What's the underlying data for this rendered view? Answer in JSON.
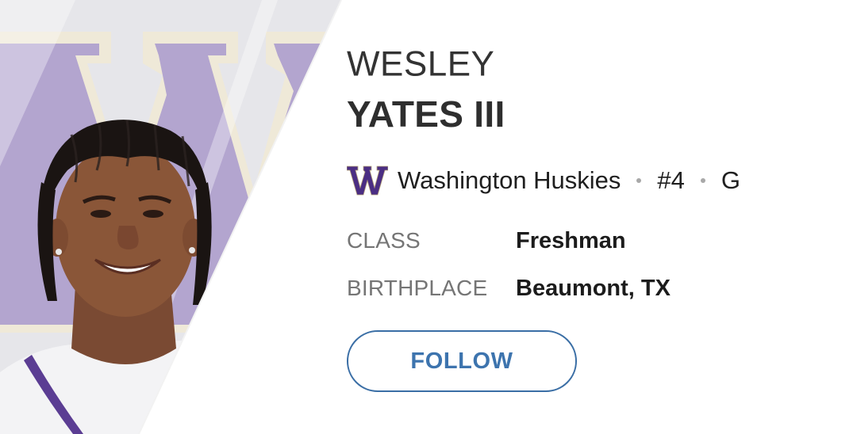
{
  "player": {
    "first_name": "WESLEY",
    "last_name": "YATES III"
  },
  "team": {
    "name": "Washington Huskies",
    "logo_letter": "W",
    "number": "#4",
    "position": "G",
    "logo_color": "#4b2e83"
  },
  "details": {
    "class_label": "CLASS",
    "class_value": "Freshman",
    "birthplace_label": "BIRTHPLACE",
    "birthplace_value": "Beaumont, TX"
  },
  "actions": {
    "follow_label": "FOLLOW",
    "accent_color": "#3a6ea5"
  },
  "hero": {
    "background_logo_color": "#b3a5cf",
    "logo_outline_color": "#efe9d8"
  }
}
